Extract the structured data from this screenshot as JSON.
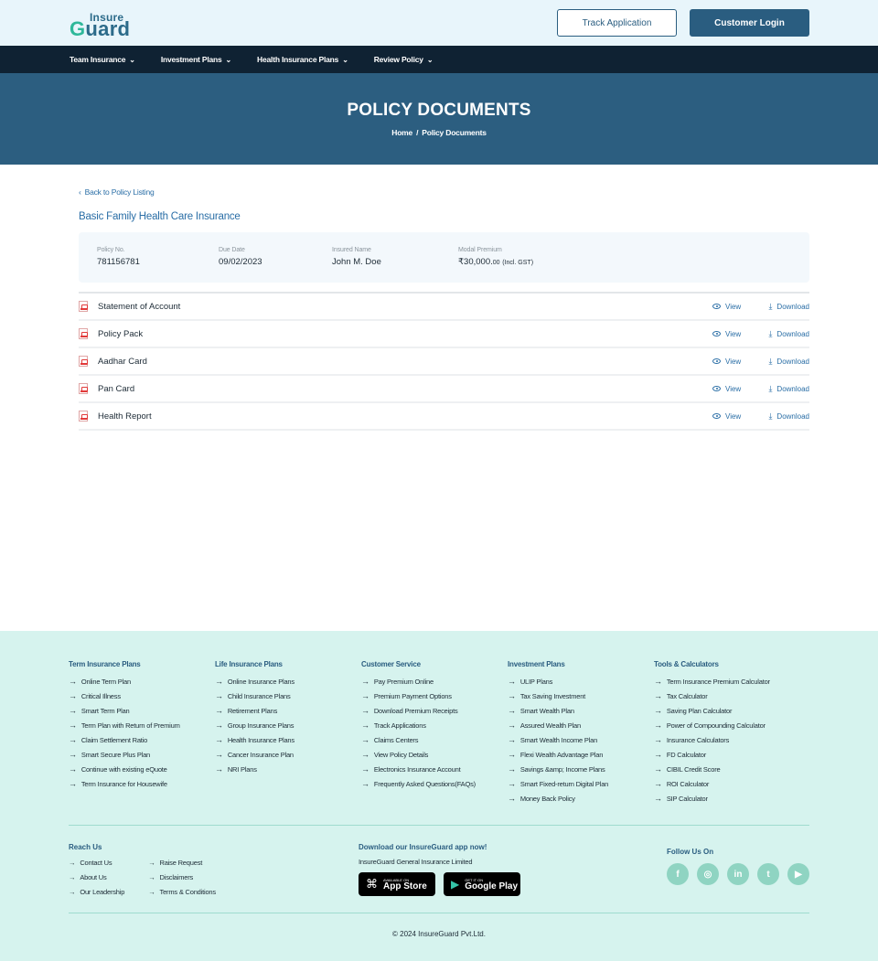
{
  "header": {
    "logo_top": "Insure",
    "logo_bottom_g": "G",
    "logo_bottom_rest": "uard",
    "track_label": "Track Application",
    "login_label": "Customer Login"
  },
  "nav": {
    "items": [
      {
        "label": "Team Insurance"
      },
      {
        "label": "Investment Plans"
      },
      {
        "label": "Health Insurance Plans"
      },
      {
        "label": "Review Policy"
      }
    ]
  },
  "hero": {
    "title": "POLICY DOCUMENTS",
    "crumb_home": "Home",
    "crumb_sep": "/",
    "crumb_current": "Policy Documents"
  },
  "main": {
    "back_label": "Back to Policy Listing",
    "policy_name": "Basic Family Health Care Insurance",
    "fields": [
      {
        "label": "Policy No.",
        "value": "781156781"
      },
      {
        "label": "Due Date",
        "value": "09/02/2023"
      },
      {
        "label": "Insured Name",
        "value": "John M. Doe"
      },
      {
        "label": "Modal Premium",
        "value": "₹30,000.",
        "decimals": "00",
        "note": "(Incl. GST)"
      }
    ],
    "view_label": "View",
    "download_label": "Download",
    "documents": [
      {
        "name": "Statement of Account"
      },
      {
        "name": "Policy Pack"
      },
      {
        "name": "Aadhar Card"
      },
      {
        "name": "Pan Card"
      },
      {
        "name": "Health Report"
      }
    ]
  },
  "footer": {
    "columns": [
      {
        "title": "Term Insurance Plans",
        "links": [
          "Online Term Plan",
          "Critical Illness",
          "Smart Term Plan",
          "Term Plan with Return of Premium",
          "Claim Settlement Ratio",
          "Smart Secure Plus Plan",
          "Continue with existing eQuote",
          "Term Insurance for Housewife"
        ]
      },
      {
        "title": "Life Insurance Plans",
        "links": [
          "Online Insurance Plans",
          "Child Insurance Plans",
          "Retirement Plans",
          "Group Insurance Plans",
          "Health Insurance Plans",
          "Cancer Insurance Plan",
          "NRI Plans"
        ]
      },
      {
        "title": "Customer Service",
        "links": [
          "Pay Premium Online",
          "Premium Payment Options",
          "Download Premium Receipts",
          "Track Applications",
          "Claims Centers",
          "View Policy Details",
          "Electronics Insurance Account",
          "Frequently Asked Questions(FAQs)"
        ]
      },
      {
        "title": "Investment Plans",
        "links": [
          "ULIP Plans",
          "Tax Saving Investment",
          "Smart Wealth Plan",
          "Assured Wealth Plan",
          "Smart Wealth Income Plan",
          "Flexi Wealth Advantage Plan",
          "Savings &amp; Income Plans",
          "Smart Fixed-return Digital Plan",
          "Money Back Policy"
        ]
      },
      {
        "title": "Tools & Calculators",
        "links": [
          "Term Insurance Premium Calculator",
          "Tax Calculator",
          "Saving Plan Calculator",
          "Power of Compounding Calculator",
          "Insurance Calculators",
          "FD Calculator",
          "CIBIL Credit Score",
          "ROI Calculator",
          "SIP Calculator"
        ]
      }
    ],
    "reach": {
      "title": "Reach Us",
      "col1": [
        "Contact Us",
        "About Us",
        "Our Leadership"
      ],
      "col2": [
        "Raise Request",
        "Disclaimers",
        "Terms & Conditions"
      ]
    },
    "app": {
      "title": "Download our InsureGuard app now!",
      "sub": "InsureGuard General Insurance Limited",
      "appstore_small": "AVAILABLE ON",
      "appstore_big": "App Store",
      "gplay_small": "GET IT ON",
      "gplay_big": "Google Play"
    },
    "follow": {
      "title": "Follow Us On",
      "icons": [
        {
          "icon": "facebook-icon",
          "glyph": "f"
        },
        {
          "icon": "instagram-icon",
          "glyph": "◎"
        },
        {
          "icon": "linkedin-icon",
          "glyph": "in"
        },
        {
          "icon": "twitter-icon",
          "glyph": "t"
        },
        {
          "icon": "youtube-icon",
          "glyph": "▶"
        }
      ]
    },
    "copyright": "© 2024 InsureGuard Pvt.Ltd."
  }
}
